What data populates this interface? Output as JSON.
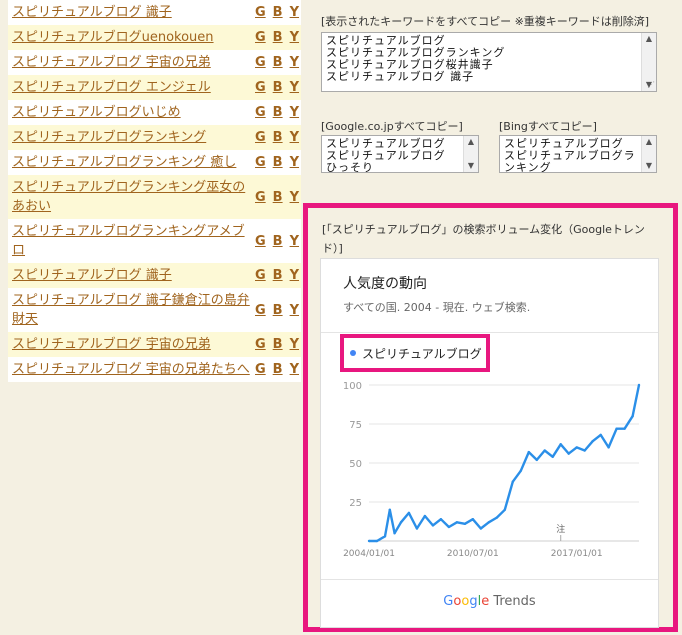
{
  "keywords": [
    {
      "text": "スピリチュアルブログ 識子",
      "tall": false
    },
    {
      "text": "スピリチュアルブログuenokouen",
      "tall": false
    },
    {
      "text": "スピリチュアルブログ 宇宙の兄弟",
      "tall": false
    },
    {
      "text": "スピリチュアルブログ エンジェル",
      "tall": false
    },
    {
      "text": "スピリチュアルブログいじめ",
      "tall": false
    },
    {
      "text": "スピリチュアルブログランキング",
      "tall": false
    },
    {
      "text": "スピリチュアルブログランキング 癒し",
      "tall": false
    },
    {
      "text": "スピリチュアルブログランキング巫女のあおい",
      "tall": true
    },
    {
      "text": "スピリチュアルブログランキングアメブロ",
      "tall": true
    },
    {
      "text": "スピリチュアルブログ 識子",
      "tall": false
    },
    {
      "text": "スピリチュアルブログ 識子鎌倉江の島弁財天",
      "tall": true
    },
    {
      "text": "スピリチュアルブログ 宇宙の兄弟",
      "tall": false
    },
    {
      "text": "スピリチュアルブログ 宇宙の兄弟たちへ",
      "tall": false
    }
  ],
  "gby": {
    "g": "G",
    "b": "B",
    "y": "Y"
  },
  "copy_all": {
    "label": "[表示されたキーワードをすべてコピー ※重複キーワードは削除済]",
    "lines": [
      "スピリチュアルブログ",
      "スピリチュアルブログランキング",
      "スピリチュアルブログ桜井識子",
      "スピリチュアルブログ 識子"
    ]
  },
  "copy_google": {
    "label": "[Google.co.jpすべてコピー]",
    "lines": [
      "スピリチュアルブログ",
      "スピリチュアルブログ",
      "ひっそり"
    ]
  },
  "copy_bing": {
    "label": "[Bingすべてコピー]",
    "lines": [
      "スピリチュアルブログ",
      "スピリチュアルブログラ",
      "ンキング"
    ]
  },
  "trends": {
    "title": "[「スピリチュアルブログ」の検索ボリューム変化（Googleトレンド）]",
    "heading": "人気度の動向",
    "subtitle": "すべての国. 2004 - 現在. ウェブ検索.",
    "legend": "スピリチュアルブログ",
    "note_marker": "注",
    "logo_trends": "Trends",
    "series_color": "#2b8fe8"
  },
  "chart_data": {
    "type": "line",
    "y_ticks": [
      "100",
      "75",
      "50",
      "25"
    ],
    "x_ticks": [
      "2004/01/01",
      "2010/07/01",
      "2017/01/01"
    ],
    "ylim": [
      0,
      100
    ],
    "x": [
      2004.0,
      2004.5,
      2005.0,
      2005.3,
      2005.6,
      2006.0,
      2006.5,
      2007.0,
      2007.5,
      2008.0,
      2008.5,
      2009.0,
      2009.5,
      2010.0,
      2010.5,
      2011.0,
      2011.5,
      2012.0,
      2012.5,
      2013.0,
      2013.5,
      2014.0,
      2014.5,
      2015.0,
      2015.5,
      2016.0,
      2016.5,
      2017.0,
      2017.5,
      2018.0,
      2018.5,
      2019.0,
      2019.5,
      2020.0,
      2020.5,
      2020.9
    ],
    "series": [
      {
        "name": "スピリチュアルブログ",
        "values": [
          0,
          0,
          3,
          20,
          5,
          12,
          18,
          8,
          16,
          10,
          14,
          9,
          12,
          11,
          14,
          8,
          12,
          15,
          20,
          38,
          45,
          57,
          52,
          58,
          54,
          62,
          56,
          60,
          58,
          64,
          68,
          60,
          72,
          72,
          80,
          100
        ]
      }
    ]
  }
}
